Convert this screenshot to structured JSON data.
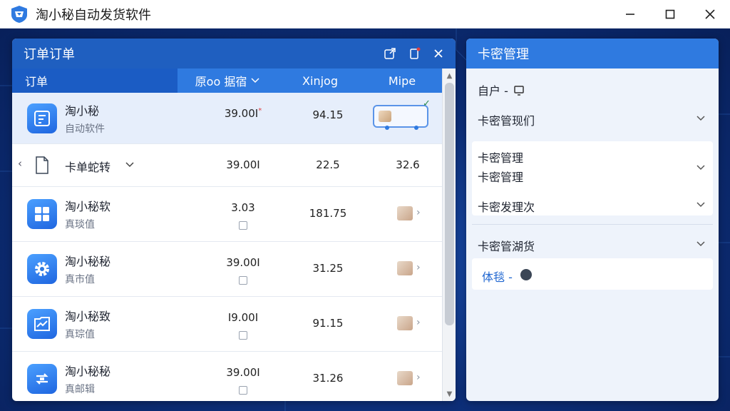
{
  "window": {
    "title": "淘小秘自动发货软件",
    "controls": [
      "minimize",
      "maximize",
      "close"
    ]
  },
  "orders_panel": {
    "title": "订单订单",
    "toolbar_icons": [
      "export-icon",
      "delete-icon",
      "close-icon"
    ],
    "columns": [
      "订单",
      "原oo 据宿",
      "Xinjog",
      "Mipe"
    ],
    "rows": [
      {
        "name": "淘小秘",
        "sub": "自动软件",
        "v1": "39.00I",
        "v2": "94.15",
        "icon": "app-icon",
        "selected": true
      },
      {
        "name": "淘小秘软",
        "sub": "真琰值",
        "v1": "3.03",
        "v2": "181.75",
        "icon": "grid-icon"
      },
      {
        "name": "淘小秘秘",
        "sub": "真市值",
        "v1": "39.00I",
        "v2": "31.25",
        "icon": "gear-icon"
      },
      {
        "name": "淘小秘致",
        "sub": "真琮值",
        "v1": "I9.00I",
        "v2": "91.15",
        "icon": "chart-icon"
      },
      {
        "name": "淘小秘秘",
        "sub": "真邮辑",
        "v1": "39.00I",
        "v2": "31.26",
        "icon": "refresh-icon"
      }
    ],
    "sub_row": {
      "name": "卡单蛇转",
      "v1": "39.00I",
      "v2": "22.5",
      "v3": "32.6"
    }
  },
  "card_panel": {
    "title": "卡密管理",
    "user_label": "自户 -",
    "items": [
      {
        "label": "卡密管现们"
      },
      {
        "label": "卡密管理",
        "sub": "卡密管理"
      },
      {
        "label": "卡密发理次"
      },
      {
        "label": "卡密管湖货"
      }
    ],
    "link_label": "体毯 -"
  },
  "colors": {
    "accent": "#2f7ae0",
    "header_dark": "#1f5fc0",
    "background": "#0b2a66"
  }
}
